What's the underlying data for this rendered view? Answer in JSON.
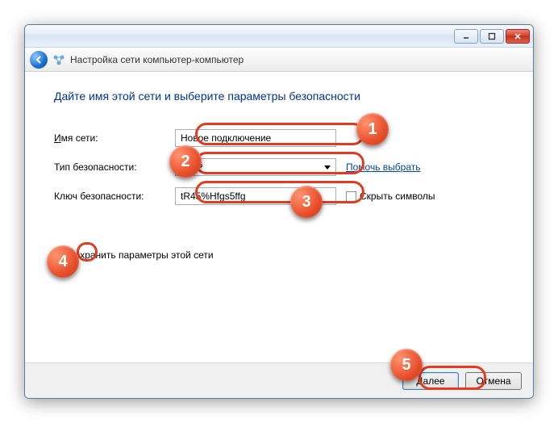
{
  "window": {
    "title": "Настройка сети компьютер-компьютер"
  },
  "heading": "Дайте имя этой сети и выберите параметры безопасности",
  "fields": {
    "network_name": {
      "label_pre": "И",
      "label_rest": "мя сети:",
      "value": "Новое подключение"
    },
    "security_type": {
      "label": "Тип безопасности:",
      "value": "WEP",
      "help": "Помочь выбрать"
    },
    "security_key": {
      "label": "Ключ безопасности:",
      "value": "tR45%Hfgs5ffg",
      "hide_label": "Скрыть символы"
    }
  },
  "save_params": {
    "label_pre": "С",
    "label_rest": "охранить параметры этой сети"
  },
  "buttons": {
    "next": "Далее",
    "cancel": "Отмена"
  },
  "badges": {
    "b1": "1",
    "b2": "2",
    "b3": "3",
    "b4": "4",
    "b5": "5"
  }
}
